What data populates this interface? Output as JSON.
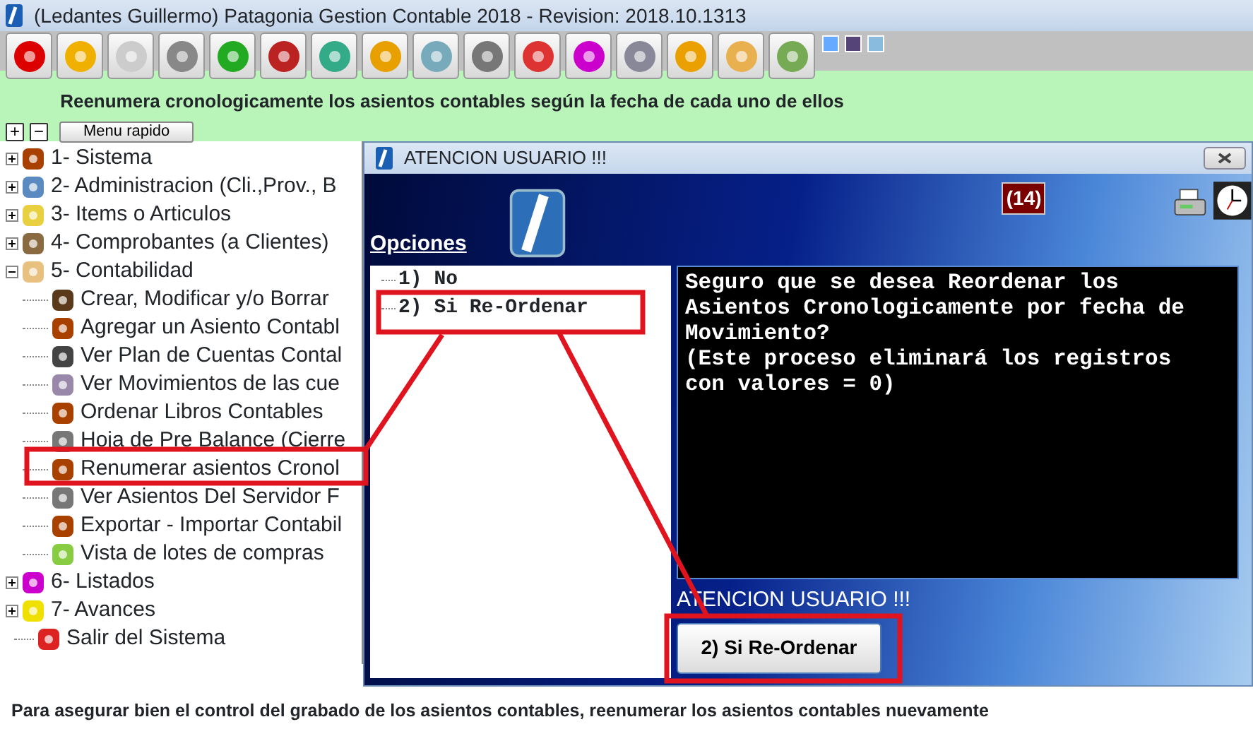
{
  "window": {
    "title": "(Ledantes Guillermo) Patagonia Gestion Contable 2018 - Revision: 2018.10.1313"
  },
  "status_hint": "Reenumera cronologicamente los asientos contables según la fecha de cada uno de ellos",
  "quick_menu": {
    "expand_label": "+",
    "collapse_label": "−",
    "button": "Menu rapido"
  },
  "tree": [
    {
      "label": "1- Sistema",
      "expanded": false
    },
    {
      "label": "2- Administracion (Cli.,Prov., B",
      "expanded": false
    },
    {
      "label": "3- Items o Articulos",
      "expanded": false
    },
    {
      "label": "4- Comprobantes (a Clientes)",
      "expanded": false
    },
    {
      "label": "5- Contabilidad",
      "expanded": true,
      "children": [
        {
          "label": "Crear, Modificar y/o Borrar"
        },
        {
          "label": "Agregar un Asiento Contabl"
        },
        {
          "label": "Ver Plan de Cuentas Contal"
        },
        {
          "label": "Ver Movimientos de las cue"
        },
        {
          "label": "Ordenar Libros Contables"
        },
        {
          "label": "Hoja de Pre Balance (Cierre"
        },
        {
          "label": "Renumerar asientos Cronol"
        },
        {
          "label": "Ver Asientos Del Servidor F"
        },
        {
          "label": "Exportar - Importar Contabil"
        },
        {
          "label": "Vista de lotes de compras"
        }
      ]
    },
    {
      "label": "6- Listados",
      "expanded": false
    },
    {
      "label": "7- Avances",
      "expanded": false
    },
    {
      "label": "Salir del Sistema"
    }
  ],
  "dialog": {
    "title": "ATENCION USUARIO !!!",
    "counter": "(14)",
    "options_label": "Opciones",
    "options": [
      {
        "label": "1) No"
      },
      {
        "label": "2) Si Re-Ordenar"
      }
    ],
    "message": "Seguro que se desea Reordenar los Asientos Cronologicamente por fecha de Movimiento?\n(Este proceso eliminará los registros con valores = 0)",
    "status": "ATENCION USUARIO !!!",
    "button": "2) Si Re-Ordenar"
  },
  "caption": "Para asegurar bien el control del grabado de los asientos contables, reenumerar los asientos contables nuevamente"
}
